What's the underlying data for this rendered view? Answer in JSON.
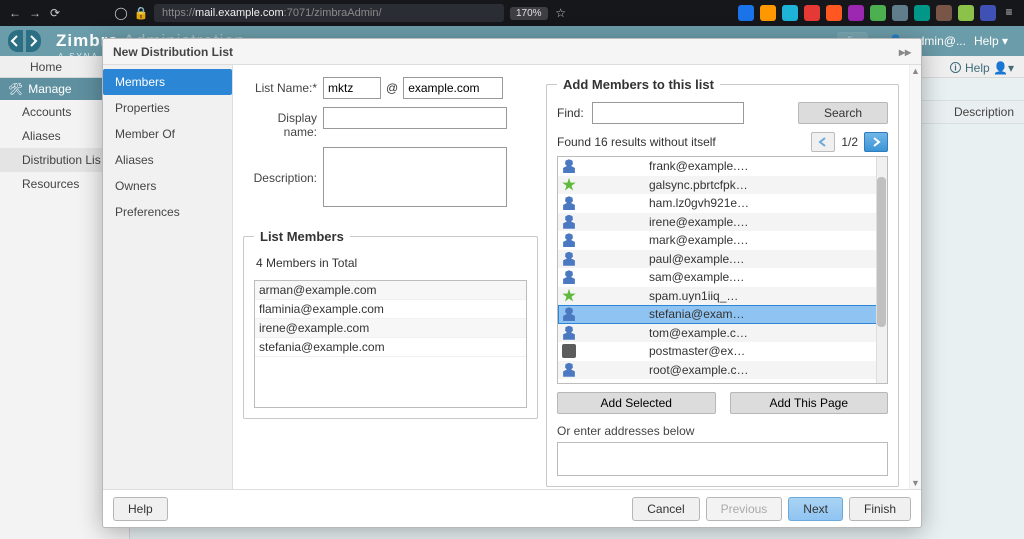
{
  "browser": {
    "url_scheme": "https://",
    "url_host": "mail.example.com",
    "url_path": ":7071/zimbraAdmin/",
    "zoom": "170%"
  },
  "app": {
    "brand1": "Zimbr",
    "brand2": "a",
    "brand_rest": " Administration",
    "sub_brand": "A SYNA",
    "help": "Help",
    "admin_label": "admin@...",
    "home_tab": "Home",
    "help2": "Help",
    "sidebar": {
      "manage": "Manage",
      "items": [
        "Accounts",
        "Aliases",
        "Distribution Lis",
        "Resources"
      ],
      "selected_index": 2
    },
    "column_desc": "Description"
  },
  "modal": {
    "title": "New Distribution List",
    "nav": [
      "Members",
      "Properties",
      "Member Of",
      "Aliases",
      "Owners",
      "Preferences"
    ],
    "nav_active": 0,
    "form": {
      "listname_label": "List Name:*",
      "listname_value": "mktz",
      "at": "@",
      "domain_value": "example.com",
      "displayname_label": "Display name:",
      "displayname_value": "",
      "description_label": "Description:",
      "description_value": ""
    },
    "members_fs": {
      "legend": "List Members",
      "count": "4 Members in Total",
      "list": [
        "arman@example.com",
        "flaminia@example.com",
        "irene@example.com",
        "stefania@example.com"
      ]
    },
    "add_fs": {
      "legend": "Add Members to this list",
      "find_label": "Find:",
      "find_value": "",
      "search_btn": "Search",
      "results_text": "Found 16 results without itself",
      "page_label": "1/2",
      "results": [
        {
          "icon": "person",
          "text": "frank@example.…"
        },
        {
          "icon": "star",
          "text": "galsync.pbrtcfpk…"
        },
        {
          "icon": "person",
          "text": "ham.lz0gvh921e…"
        },
        {
          "icon": "person",
          "text": "irene@example.…"
        },
        {
          "icon": "person",
          "text": "mark@example.…"
        },
        {
          "icon": "person",
          "text": "paul@example.…"
        },
        {
          "icon": "person",
          "text": "sam@example.…"
        },
        {
          "icon": "star",
          "text": "spam.uyn1iiq_…"
        },
        {
          "icon": "person",
          "text": "stefania@exam…",
          "selected": true
        },
        {
          "icon": "person",
          "text": "tom@example.c…"
        },
        {
          "icon": "robot",
          "text": "postmaster@ex…"
        },
        {
          "icon": "person",
          "text": "root@example.c…"
        }
      ],
      "add_selected": "Add Selected",
      "add_page": "Add This Page",
      "or_label": "Or enter addresses below",
      "addresses_value": ""
    },
    "footer": {
      "help": "Help",
      "cancel": "Cancel",
      "previous": "Previous",
      "next": "Next",
      "finish": "Finish"
    }
  }
}
